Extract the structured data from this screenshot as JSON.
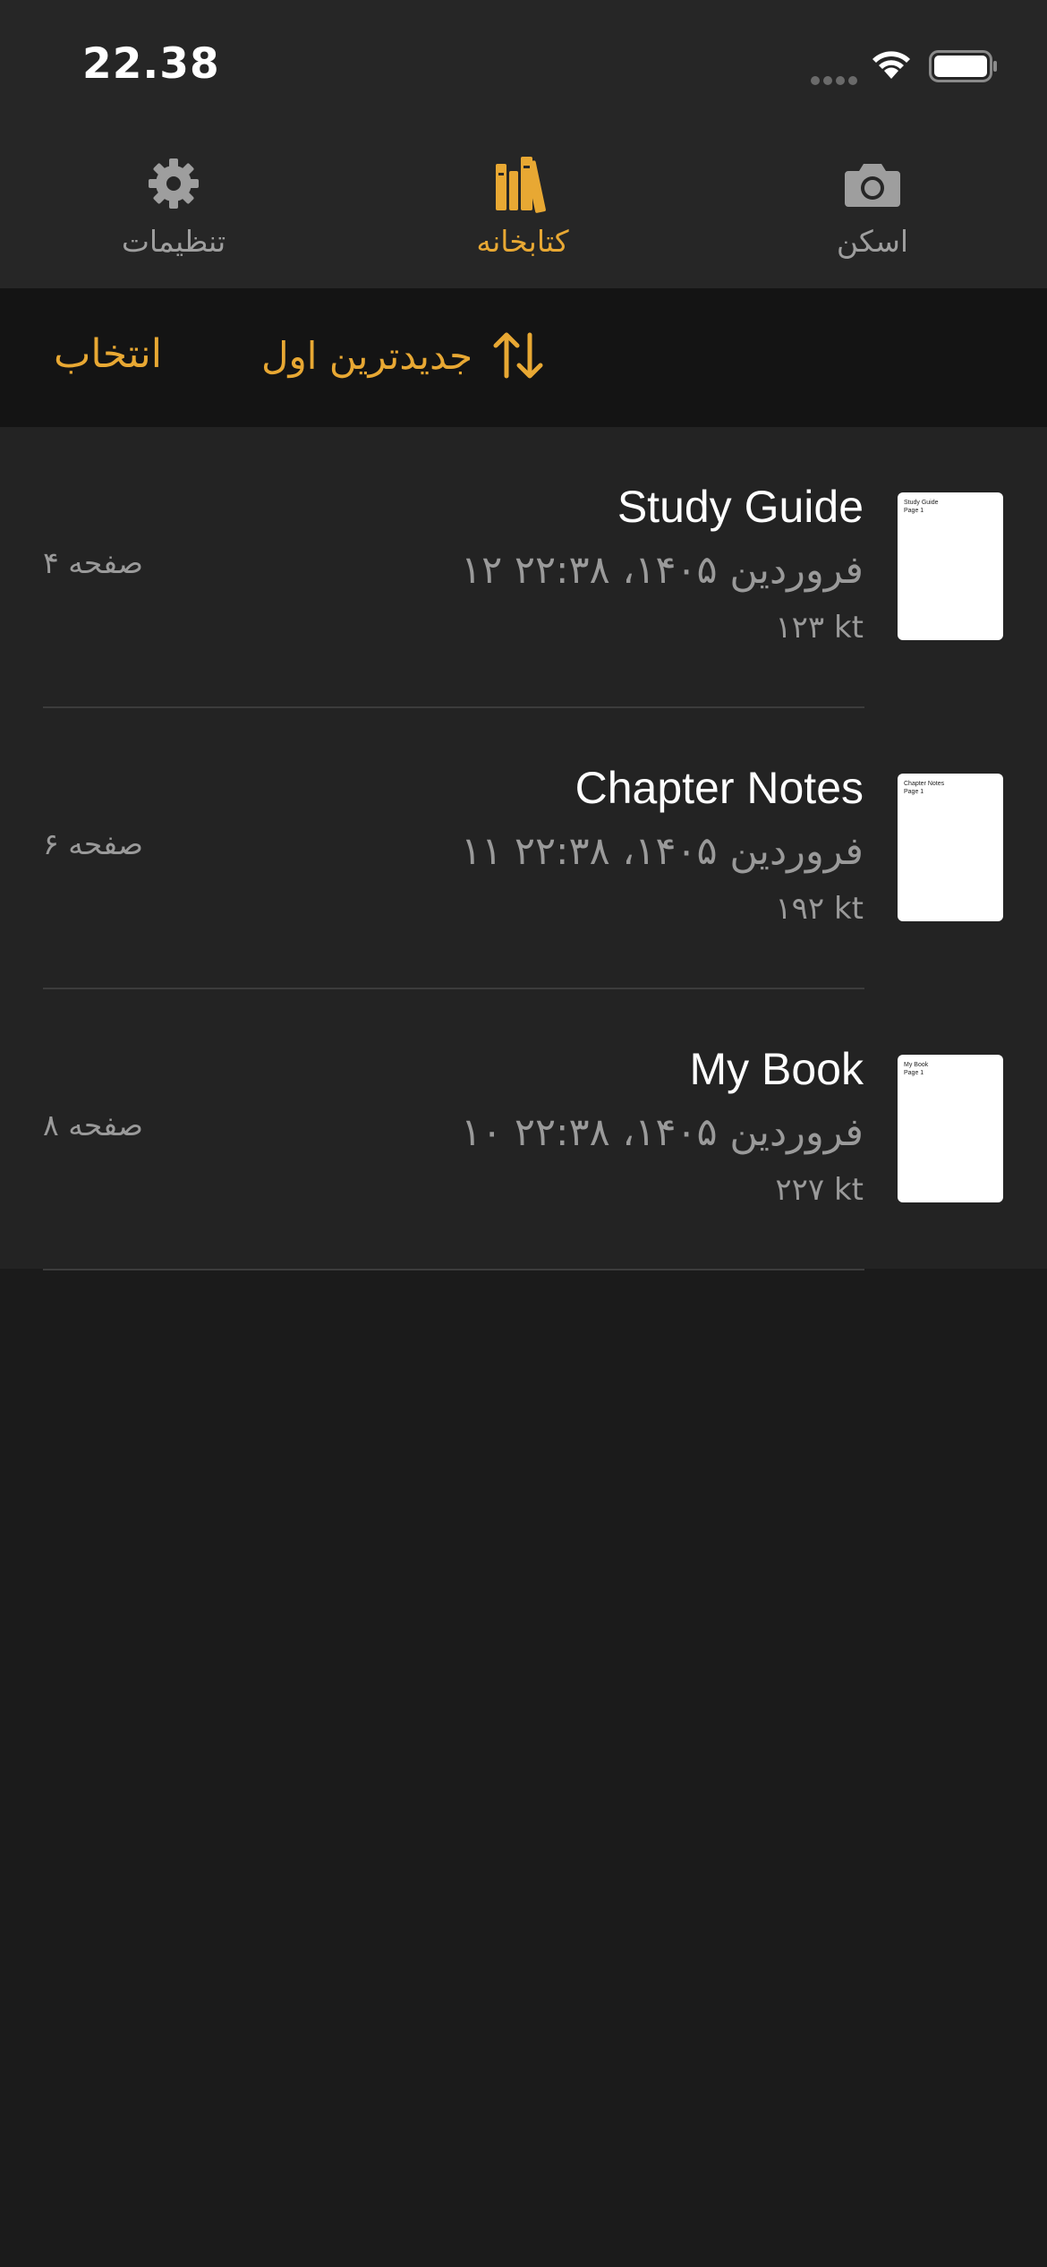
{
  "status_bar": {
    "time": "22.38"
  },
  "tabs": {
    "settings": {
      "label": "تنظیمات",
      "icon": "gear-icon"
    },
    "library": {
      "label": "کتابخانه",
      "icon": "books-icon",
      "active": true
    },
    "scan": {
      "label": "اسکن",
      "icon": "camera-icon"
    }
  },
  "toolbar": {
    "select_label": "انتخاب",
    "sort_label": "جدیدترین اول",
    "sort_icon": "sort-arrows-icon"
  },
  "colors": {
    "accent": "#e8a833",
    "background": "#1b1b1b",
    "list_background": "#232323",
    "toolbar_background": "#141414",
    "secondary_text": "#9a9a9a"
  },
  "documents": [
    {
      "title": "Study Guide",
      "date": "۱۲ فروردین ۱۴۰۵، ۲۲:۳۸",
      "size": "۱۲۳ kt",
      "pages": "۴ صفحه",
      "thumb_lines": [
        "Study Guide",
        "Page 1"
      ]
    },
    {
      "title": "Chapter Notes",
      "date": "۱۱ فروردین ۱۴۰۵، ۲۲:۳۸",
      "size": "۱۹۲ kt",
      "pages": "۶ صفحه",
      "thumb_lines": [
        "Chapter Notes",
        "Page 1"
      ]
    },
    {
      "title": "My Book",
      "date": "۱۰ فروردین ۱۴۰۵، ۲۲:۳۸",
      "size": "۲۲۷ kt",
      "pages": "۸ صفحه",
      "thumb_lines": [
        "My Book",
        "Page 1"
      ]
    }
  ]
}
